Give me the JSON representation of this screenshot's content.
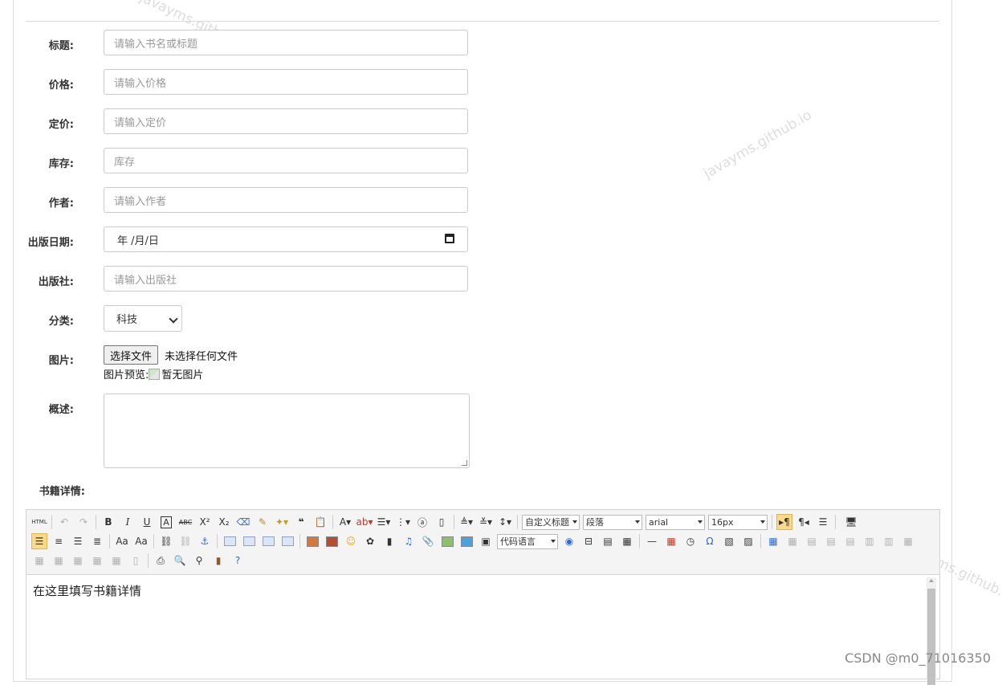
{
  "watermark": "javayms.github.io",
  "form": {
    "title": {
      "label": "标题:",
      "placeholder": "请输入书名或标题"
    },
    "price": {
      "label": "价格:",
      "placeholder": "请输入价格"
    },
    "list_price": {
      "label": "定价:",
      "placeholder": "请输入定价"
    },
    "stock": {
      "label": "库存:",
      "placeholder": "库存"
    },
    "author": {
      "label": "作者:",
      "placeholder": "请输入作者"
    },
    "publish_date": {
      "label": "出版日期:",
      "value": "年 /月/日"
    },
    "publisher": {
      "label": "出版社:",
      "placeholder": "请输入出版社"
    },
    "category": {
      "label": "分类:",
      "value": "科技"
    },
    "image": {
      "label": "图片:",
      "button": "选择文件",
      "status": "未选择任何文件",
      "preview_label": "图片预览:",
      "preview_alt": "暂无图片"
    },
    "summary": {
      "label": "概述:",
      "value": ""
    },
    "details": {
      "label": "书籍详情:"
    }
  },
  "editor": {
    "content": "在这里填写书籍详情",
    "custom_heading": "自定义标题",
    "paragraph": "段落",
    "font_family": "arial",
    "font_size": "16px",
    "code_language": "代码语言"
  },
  "footer": {
    "csdn": "CSDN @m0_71016350"
  }
}
